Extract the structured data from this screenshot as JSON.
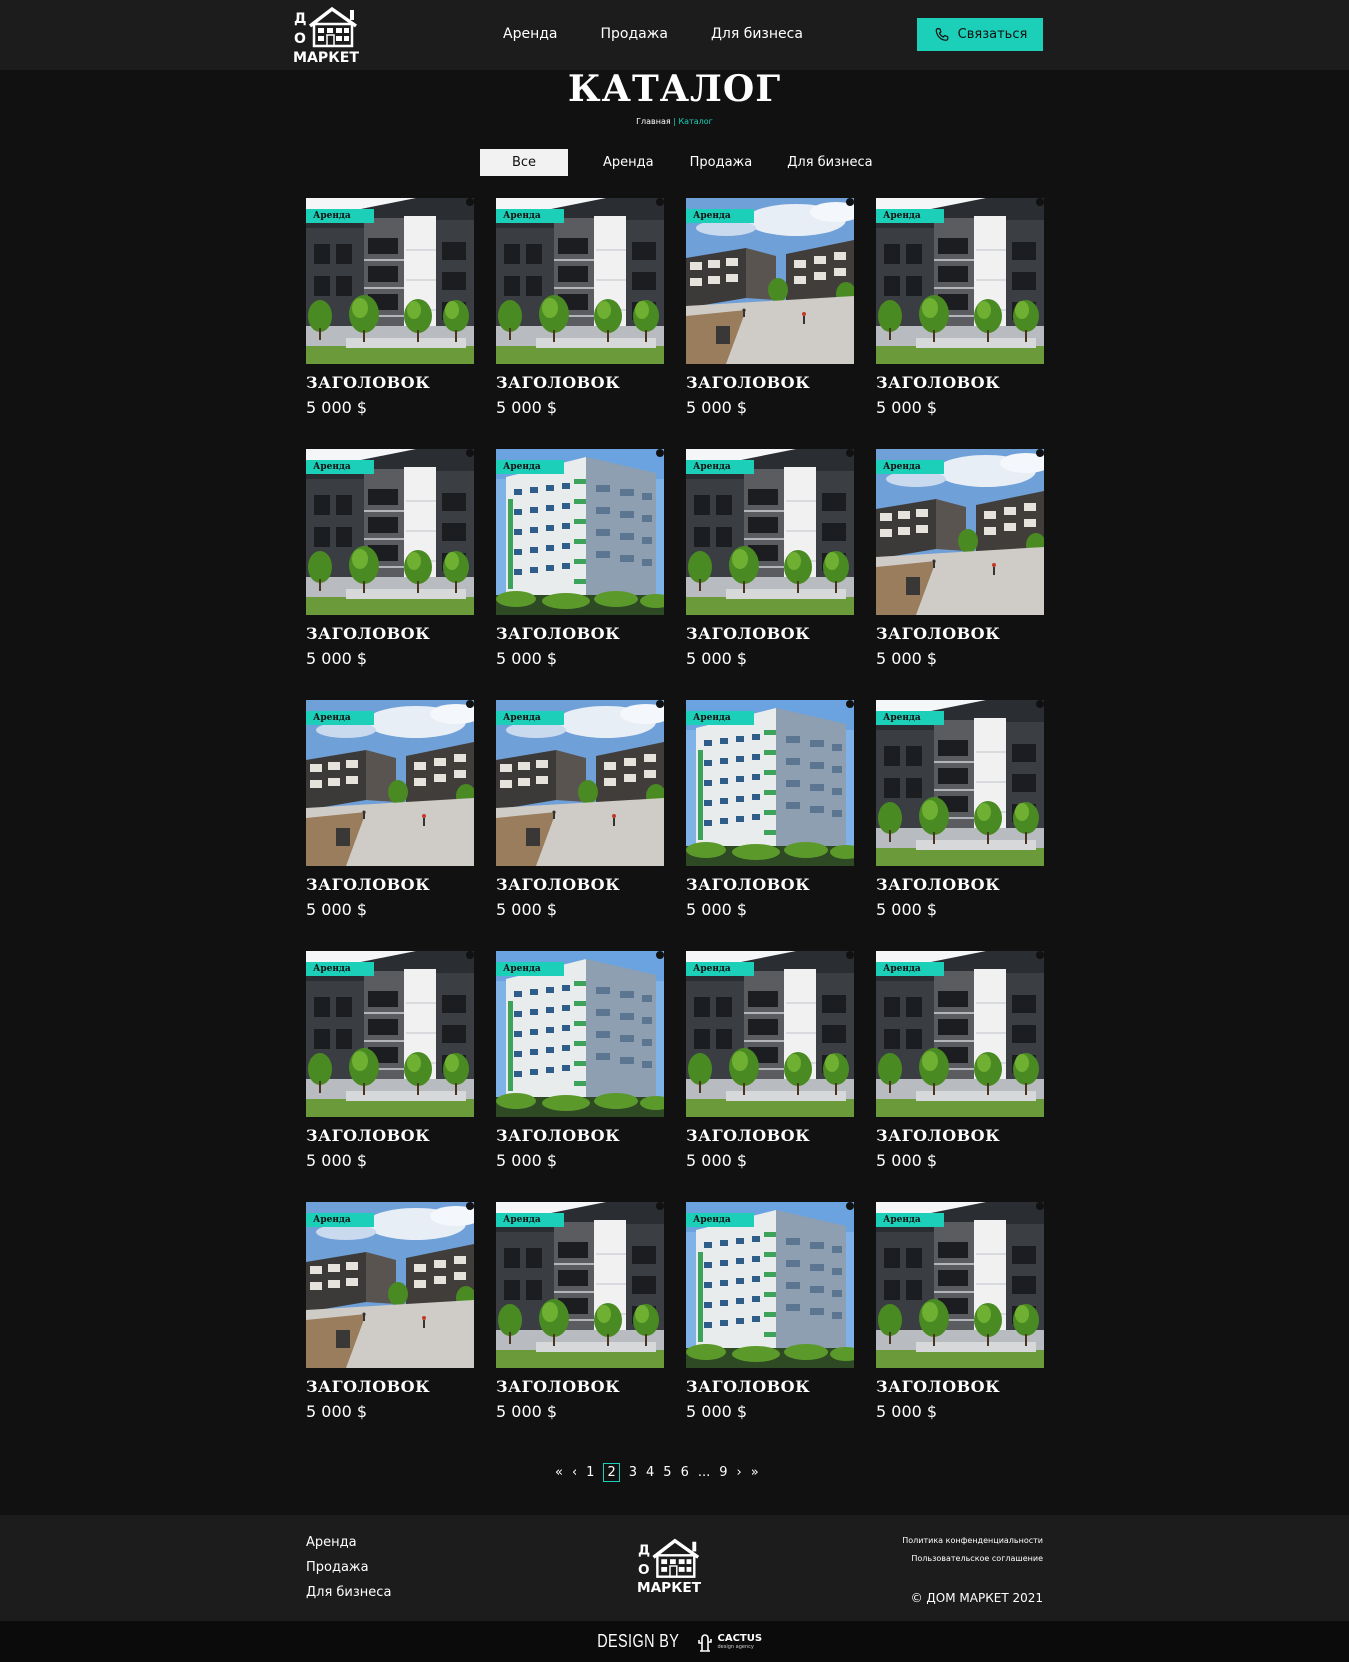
{
  "header": {
    "logo_text": "ДОМ МАРКЕТ",
    "nav": [
      "Аренда",
      "Продажа",
      "Для бизнеса"
    ],
    "contact_label": "Связаться"
  },
  "page": {
    "title": "КАТАЛОГ",
    "breadcrumb": {
      "home": "Главная",
      "separator": "|",
      "current": "Каталог"
    }
  },
  "filters": [
    "Все",
    "Аренда",
    "Продажа",
    "Для бизнеса"
  ],
  "filter_active": "Все",
  "cards": [
    {
      "badge": "Аренда",
      "title": "ЗАГОЛОВОК",
      "price": "5 000 $",
      "image": "townhouse-dark-building"
    },
    {
      "badge": "Аренда",
      "title": "ЗАГОЛОВОК",
      "price": "5 000 $",
      "image": "townhouse-dark-building"
    },
    {
      "badge": "Аренда",
      "title": "ЗАГОЛОВОК",
      "price": "5 000 $",
      "image": "courtyard-complex"
    },
    {
      "badge": "Аренда",
      "title": "ЗАГОЛОВОК",
      "price": "5 000 $",
      "image": "townhouse-dark-building"
    },
    {
      "badge": "Аренда",
      "title": "ЗАГОЛОВОК",
      "price": "5 000 $",
      "image": "townhouse-dark-building"
    },
    {
      "badge": "Аренда",
      "title": "ЗАГОЛОВОК",
      "price": "5 000 $",
      "image": "high-rise-green"
    },
    {
      "badge": "Аренда",
      "title": "ЗАГОЛОВОК",
      "price": "5 000 $",
      "image": "townhouse-dark-building"
    },
    {
      "badge": "Аренда",
      "title": "ЗАГОЛОВОК",
      "price": "5 000 $",
      "image": "courtyard-complex"
    },
    {
      "badge": "Аренда",
      "title": "ЗАГОЛОВОК",
      "price": "5 000 $",
      "image": "courtyard-complex"
    },
    {
      "badge": "Аренда",
      "title": "ЗАГОЛОВОК",
      "price": "5 000 $",
      "image": "courtyard-complex"
    },
    {
      "badge": "Аренда",
      "title": "ЗАГОЛОВОК",
      "price": "5 000 $",
      "image": "high-rise-green"
    },
    {
      "badge": "Аренда",
      "title": "ЗАГОЛОВОК",
      "price": "5 000 $",
      "image": "townhouse-dark-building"
    },
    {
      "badge": "Аренда",
      "title": "ЗАГОЛОВОК",
      "price": "5 000 $",
      "image": "townhouse-dark-building"
    },
    {
      "badge": "Аренда",
      "title": "ЗАГОЛОВОК",
      "price": "5 000 $",
      "image": "high-rise-green"
    },
    {
      "badge": "Аренда",
      "title": "ЗАГОЛОВОК",
      "price": "5 000 $",
      "image": "townhouse-dark-building"
    },
    {
      "badge": "Аренда",
      "title": "ЗАГОЛОВОК",
      "price": "5 000 $",
      "image": "townhouse-dark-building"
    },
    {
      "badge": "Аренда",
      "title": "ЗАГОЛОВОК",
      "price": "5 000 $",
      "image": "courtyard-complex"
    },
    {
      "badge": "Аренда",
      "title": "ЗАГОЛОВОК",
      "price": "5 000 $",
      "image": "townhouse-dark-building"
    },
    {
      "badge": "Аренда",
      "title": "ЗАГОЛОВОК",
      "price": "5 000 $",
      "image": "high-rise-green"
    },
    {
      "badge": "Аренда",
      "title": "ЗАГОЛОВОК",
      "price": "5 000 $",
      "image": "townhouse-dark-building"
    }
  ],
  "pagination": {
    "first": "«",
    "prev": "‹",
    "pages": [
      "1",
      "2",
      "3",
      "4",
      "5",
      "6",
      "...",
      "9"
    ],
    "current": "2",
    "next": "›",
    "last": "»"
  },
  "footer": {
    "links": [
      "Аренда",
      "Продажа",
      "Для бизнеса"
    ],
    "legal": [
      "Политика конфенденциальности",
      "Пользовательское соглашение"
    ],
    "copyright": "© ДОМ МАРКЕТ 2021"
  },
  "credit": {
    "label": "DESIGN BY",
    "brand": "CACTUS",
    "brand_sub": "design agency"
  },
  "colors": {
    "accent": "#1ccfb8",
    "background": "#111111",
    "header": "#1c1c1c"
  }
}
